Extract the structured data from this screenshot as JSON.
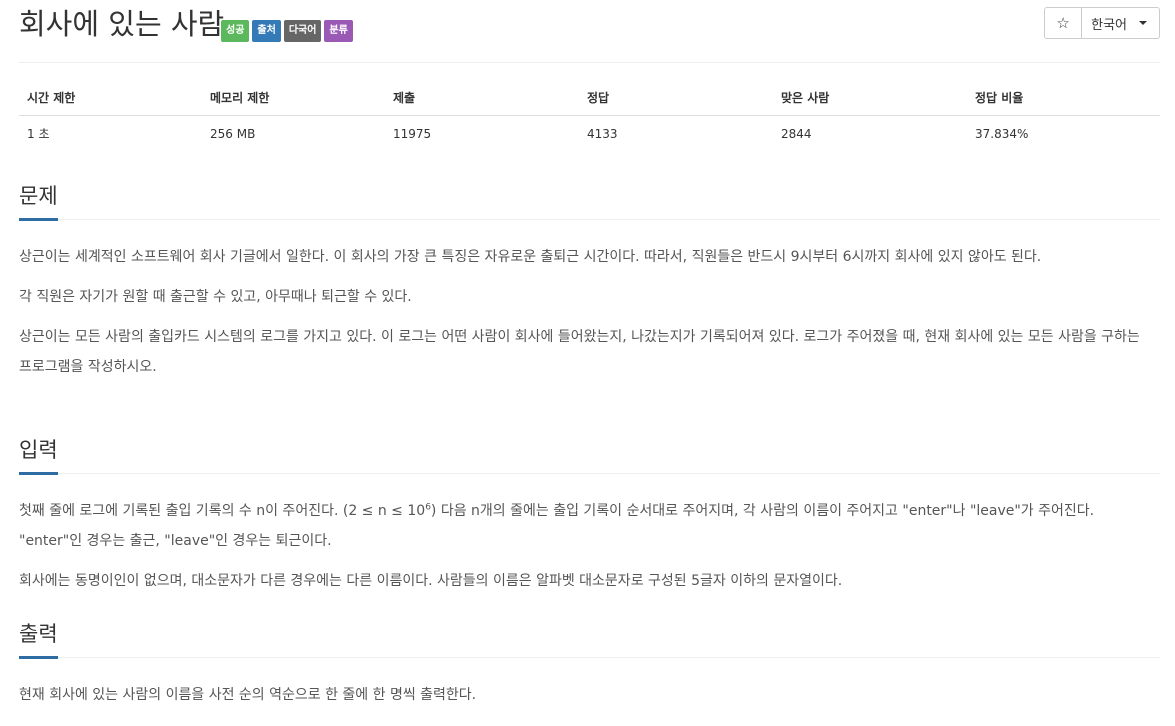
{
  "header": {
    "title": "회사에 있는 사람",
    "labels": [
      {
        "text": "성공",
        "color": "#5cb85c"
      },
      {
        "text": "출처",
        "color": "#337ab7"
      },
      {
        "text": "다국어",
        "color": "#666666"
      },
      {
        "text": "분류",
        "color": "#9b59b6"
      }
    ],
    "star_icon": "star-outline-icon",
    "star_glyph": "☆",
    "language": "한국어"
  },
  "stats": {
    "headers": [
      "시간 제한",
      "메모리 제한",
      "제출",
      "정답",
      "맞은 사람",
      "정답 비율"
    ],
    "values": [
      "1 초",
      "256 MB",
      "11975",
      "4133",
      "2844",
      "37.834%"
    ]
  },
  "problem": {
    "title": "문제",
    "p1": "상근이는 세계적인 소프트웨어 회사 기글에서 일한다. 이 회사의 가장 큰 특징은 자유로운 출퇴근 시간이다. 따라서, 직원들은 반드시 9시부터 6시까지 회사에 있지 않아도 된다.",
    "p2": "각 직원은 자기가 원할 때 출근할 수 있고, 아무때나 퇴근할 수 있다.",
    "p3": "상근이는 모든 사람의 출입카드 시스템의 로그를 가지고 있다. 이 로그는 어떤 사람이 회사에 들어왔는지, 나갔는지가 기록되어져 있다. 로그가 주어졌을 때, 현재 회사에 있는 모든 사람을 구하는 프로그램을 작성하시오."
  },
  "input": {
    "title": "입력",
    "p1_before": "첫째 줄에 로그에 기록된 출입 기록의 수 n이 주어진다. (2 ≤ n ≤ 10",
    "p1_sup": "6",
    "p1_after": ") 다음 n개의 줄에는 출입 기록이 순서대로 주어지며, 각 사람의 이름이 주어지고 \"enter\"나 \"leave\"가 주어진다. \"enter\"인 경우는 출근, \"leave\"인 경우는 퇴근이다.",
    "p2": "회사에는 동명이인이 없으며, 대소문자가 다른 경우에는 다른 이름이다. 사람들의 이름은 알파벳 대소문자로 구성된 5글자 이하의 문자열이다."
  },
  "output": {
    "title": "출력",
    "p1": "현재 회사에 있는 사람의 이름을 사전 순의 역순으로 한 줄에 한 명씩 출력한다."
  }
}
